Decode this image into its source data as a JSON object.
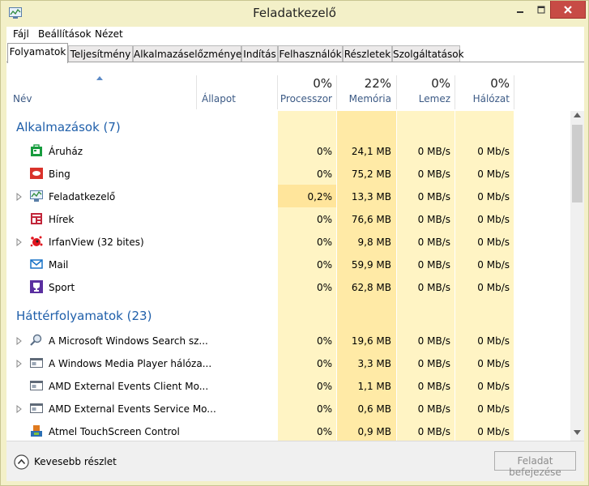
{
  "window": {
    "title": "Feladatkezelő"
  },
  "menu": [
    "Fájl",
    "Beállítások",
    "Nézet"
  ],
  "tabs": [
    "Folyamatok",
    "Teljesítmény",
    "Alkalmazáselőzmények",
    "Indítás",
    "Felhasználók",
    "Részletek",
    "Szolgáltatások"
  ],
  "columns": {
    "name": "Név",
    "status": "Állapot",
    "cpu": {
      "pct": "0%",
      "label": "Processzor"
    },
    "memory": {
      "pct": "22%",
      "label": "Memória"
    },
    "disk": {
      "pct": "0%",
      "label": "Lemez"
    },
    "network": {
      "pct": "0%",
      "label": "Hálózat"
    }
  },
  "groups": [
    {
      "title": "Alkalmazások (7)",
      "rows": [
        {
          "name": "Áruház",
          "icon": "store-icon",
          "expandable": false,
          "cpu": "0%",
          "mem": "24,1 MB",
          "disk": "0 MB/s",
          "net": "0 Mb/s"
        },
        {
          "name": "Bing",
          "icon": "bing-icon",
          "expandable": false,
          "cpu": "0%",
          "mem": "75,2 MB",
          "disk": "0 MB/s",
          "net": "0 Mb/s"
        },
        {
          "name": "Feladatkezelő",
          "icon": "task-manager-icon",
          "expandable": true,
          "cpu": "0,2%",
          "mem": "13,3 MB",
          "disk": "0 MB/s",
          "net": "0 Mb/s"
        },
        {
          "name": "Hírek",
          "icon": "news-icon",
          "expandable": false,
          "cpu": "0%",
          "mem": "76,6 MB",
          "disk": "0 MB/s",
          "net": "0 Mb/s"
        },
        {
          "name": "IrfanView (32 bites)",
          "icon": "irfanview-icon",
          "expandable": true,
          "cpu": "0%",
          "mem": "9,8 MB",
          "disk": "0 MB/s",
          "net": "0 Mb/s"
        },
        {
          "name": "Mail",
          "icon": "mail-icon",
          "expandable": false,
          "cpu": "0%",
          "mem": "59,9 MB",
          "disk": "0 MB/s",
          "net": "0 Mb/s"
        },
        {
          "name": "Sport",
          "icon": "trophy-icon",
          "expandable": false,
          "cpu": "0%",
          "mem": "62,8 MB",
          "disk": "0 MB/s",
          "net": "0 Mb/s"
        }
      ]
    },
    {
      "title": "Háttérfolyamatok (23)",
      "rows": [
        {
          "name": "A Microsoft Windows Search sz...",
          "icon": "search-service-icon",
          "expandable": true,
          "cpu": "0%",
          "mem": "19,6 MB",
          "disk": "0 MB/s",
          "net": "0 Mb/s"
        },
        {
          "name": "A Windows Media Player hálóza...",
          "icon": "service-window-icon",
          "expandable": true,
          "cpu": "0%",
          "mem": "3,3 MB",
          "disk": "0 MB/s",
          "net": "0 Mb/s"
        },
        {
          "name": "AMD External Events Client Mo...",
          "icon": "service-window-icon",
          "expandable": false,
          "cpu": "0%",
          "mem": "1,1 MB",
          "disk": "0 MB/s",
          "net": "0 Mb/s"
        },
        {
          "name": "AMD External Events Service Mo...",
          "icon": "service-window-icon",
          "expandable": true,
          "cpu": "0%",
          "mem": "0,6 MB",
          "disk": "0 MB/s",
          "net": "0 Mb/s"
        },
        {
          "name": "Atmel TouchScreen Control",
          "icon": "touchscreen-icon",
          "expandable": false,
          "cpu": "0%",
          "mem": "0,9 MB",
          "disk": "0 MB/s",
          "net": "0 Mb/s"
        }
      ]
    }
  ],
  "footer": {
    "fewer_details": "Kevesebb részlet",
    "end_task": "Feladat befejezése"
  }
}
